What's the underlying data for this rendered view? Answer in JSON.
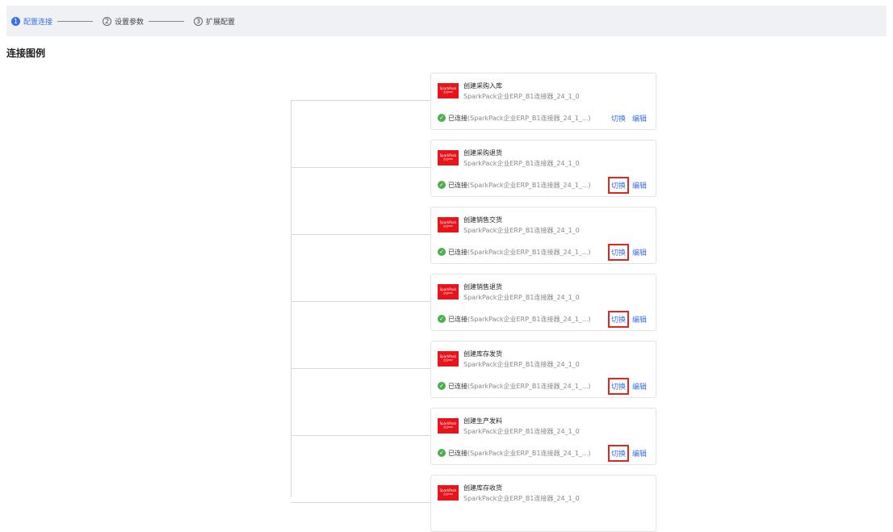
{
  "steps": [
    {
      "num": "1",
      "label": "配置连接"
    },
    {
      "num": "2",
      "label": "设置参数"
    },
    {
      "num": "3",
      "label": "扩展配置"
    }
  ],
  "section_title": "连接图例",
  "logo": {
    "brand": "SparkPack",
    "sub": "企业ERP"
  },
  "cards": [
    {
      "title": "创建采购入库",
      "subtitle": "SparkPack企业ERP_B1连接器_24_1_0",
      "status": "已连接",
      "detail": "(SparkPack企业ERP_B1连接器_24_1_...)",
      "switch": "切换",
      "edit": "编辑",
      "highlight": false
    },
    {
      "title": "创建采购退货",
      "subtitle": "SparkPack企业ERP_B1连接器_24_1_0",
      "status": "已连接",
      "detail": "(SparkPack企业ERP_B1连接器_24_1_...)",
      "switch": "切换",
      "edit": "编辑",
      "highlight": true
    },
    {
      "title": "创建销售交货",
      "subtitle": "SparkPack企业ERP_B1连接器_24_1_0",
      "status": "已连接",
      "detail": "(SparkPack企业ERP_B1连接器_24_1_...)",
      "switch": "切换",
      "edit": "编辑",
      "highlight": true
    },
    {
      "title": "创建销售退货",
      "subtitle": "SparkPack企业ERP_B1连接器_24_1_0",
      "status": "已连接",
      "detail": "(SparkPack企业ERP_B1连接器_24_1_...)",
      "switch": "切换",
      "edit": "编辑",
      "highlight": true
    },
    {
      "title": "创建库存发货",
      "subtitle": "SparkPack企业ERP_B1连接器_24_1_0",
      "status": "已连接",
      "detail": "(SparkPack企业ERP_B1连接器_24_1_...)",
      "switch": "切换",
      "edit": "编辑",
      "highlight": true
    },
    {
      "title": "创建生产发料",
      "subtitle": "SparkPack企业ERP_B1连接器_24_1_0",
      "status": "已连接",
      "detail": "(SparkPack企业ERP_B1连接器_24_1_...)",
      "switch": "切换",
      "edit": "编辑",
      "highlight": true
    },
    {
      "title": "创建库存收货",
      "subtitle": "SparkPack企业ERP_B1连接器_24_1_0",
      "status": "",
      "detail": "",
      "switch": "",
      "edit": "",
      "highlight": false
    }
  ],
  "colors": {
    "accent": "#3a6fe6",
    "success": "#4cb050",
    "highlight_border": "#e1261d",
    "logo_red": "#e8141b"
  }
}
